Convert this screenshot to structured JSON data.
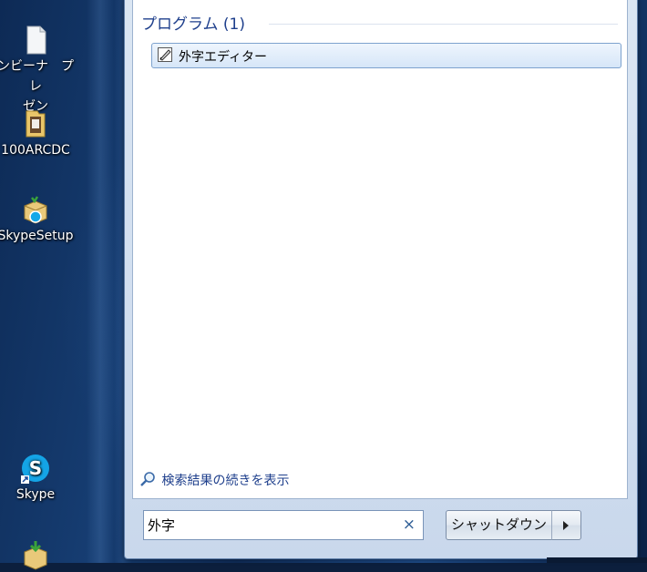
{
  "desktop": {
    "icons": [
      {
        "label": "ンビーナ　プレ\nゼン",
        "icon": "document-icon"
      },
      {
        "label": "100ARCDC",
        "icon": "folder-icon"
      },
      {
        "label": "SkypeSetup",
        "icon": "installer-icon"
      },
      {
        "label": "Skype",
        "icon": "skype-icon"
      },
      {
        "label": "",
        "icon": "installer-icon"
      }
    ]
  },
  "start_menu": {
    "section_header": "プログラム (1)",
    "results": [
      {
        "label": "外字エディター",
        "icon": "eudc-editor-icon"
      }
    ],
    "see_more": "検索結果の続きを表示",
    "search": {
      "value": "外字",
      "clear_icon": "×"
    },
    "shutdown_label": "シャットダウン"
  }
}
